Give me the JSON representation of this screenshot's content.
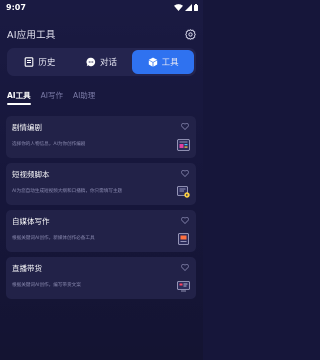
{
  "status_bar": {
    "time": "9:07"
  },
  "header": {
    "title": "AI应用工具",
    "settings_icon": "gear-icon"
  },
  "mode_tabs": [
    {
      "label": "历史",
      "icon": "history-doc-icon",
      "active": false
    },
    {
      "label": "对话",
      "icon": "chat-bubble-icon",
      "active": false
    },
    {
      "label": "工具",
      "icon": "cube-icon",
      "active": true
    }
  ],
  "sub_tabs": [
    {
      "label": "AI工具",
      "active": true
    },
    {
      "label": "AI写作",
      "active": false
    },
    {
      "label": "AI助理",
      "active": false
    }
  ],
  "tools": [
    {
      "title": "剧情编剧",
      "desc": "选择你的人物信息，AI为你创作编剧",
      "icon": "script-icon",
      "fav_icon": "heart-icon"
    },
    {
      "title": "短视频脚本",
      "desc": "AI为您自动生成短视频大纲和口播稿，你只需填写主题",
      "icon": "video-script-icon",
      "fav_icon": "heart-icon"
    },
    {
      "title": "自媒体写作",
      "desc": "根据关键词AI创作，新媒体创作必备工具",
      "icon": "media-writing-icon",
      "fav_icon": "heart-icon"
    },
    {
      "title": "直播带货",
      "desc": "根据关键词AI创作，编写带货文案",
      "icon": "live-sales-icon",
      "fav_icon": "heart-icon"
    }
  ],
  "colors": {
    "background": "#16163a",
    "card": "#222248",
    "accent": "#2f72f0",
    "muted_text": "#8a8ab0"
  }
}
